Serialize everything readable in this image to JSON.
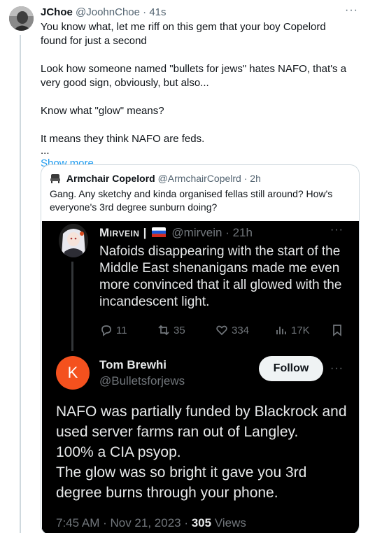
{
  "post": {
    "name": "JChoe",
    "handle": "@JoohnChoe",
    "time": "· 41s",
    "more": "···",
    "paragraphs": [
      "You know what, let me riff on this gem that your boy Copelord found for just a second",
      "Look how someone named \"bullets for jews\" hates NAFO, that's a very good sign, obviously, but also...",
      "Know what \"glow\" means?",
      "It means they think NAFO are feds.",
      "..."
    ],
    "show_more": "Show more"
  },
  "quote": {
    "icon": "armchair-icon",
    "name": "Armchair Copelord",
    "handle": "@ArmchairCopelrd",
    "time": "· 2h",
    "text": "Gang. Any sketchy and kinda organised fellas still around? How's everyone's 3rd degree sunburn doing?"
  },
  "screenshot": {
    "tweet1": {
      "name": "Mirvein |",
      "handle": "@mirvein",
      "time": "· 21h",
      "more": "···",
      "text": "Nafoids disappearing with the start of the Middle East shenanigans made me even more convinced that it all glowed with the incandescent light.",
      "replies": "11",
      "retweets": "35",
      "likes": "334",
      "views": "17K"
    },
    "tweet2": {
      "avatar_letter": "K",
      "avatar_color": "#f4511e",
      "name": "Tom Brewhi",
      "handle": "@Bulletsforjews",
      "follow": "Follow",
      "more": "···",
      "lines": [
        "NAFO was partially funded by Blackrock and used server farms ran out of Langley.",
        "100% a CIA psyop.",
        "The glow was so bright it gave you 3rd degree burns through your phone."
      ],
      "meta_time": "7:45 AM · Nov 21, 2023 · ",
      "meta_views_count": "305",
      "meta_views_label": " Views"
    }
  },
  "colors": {
    "link": "#1d9bf0",
    "muted": "#536471",
    "dark_bg": "#000000",
    "dark_text": "#e7e9ea"
  }
}
